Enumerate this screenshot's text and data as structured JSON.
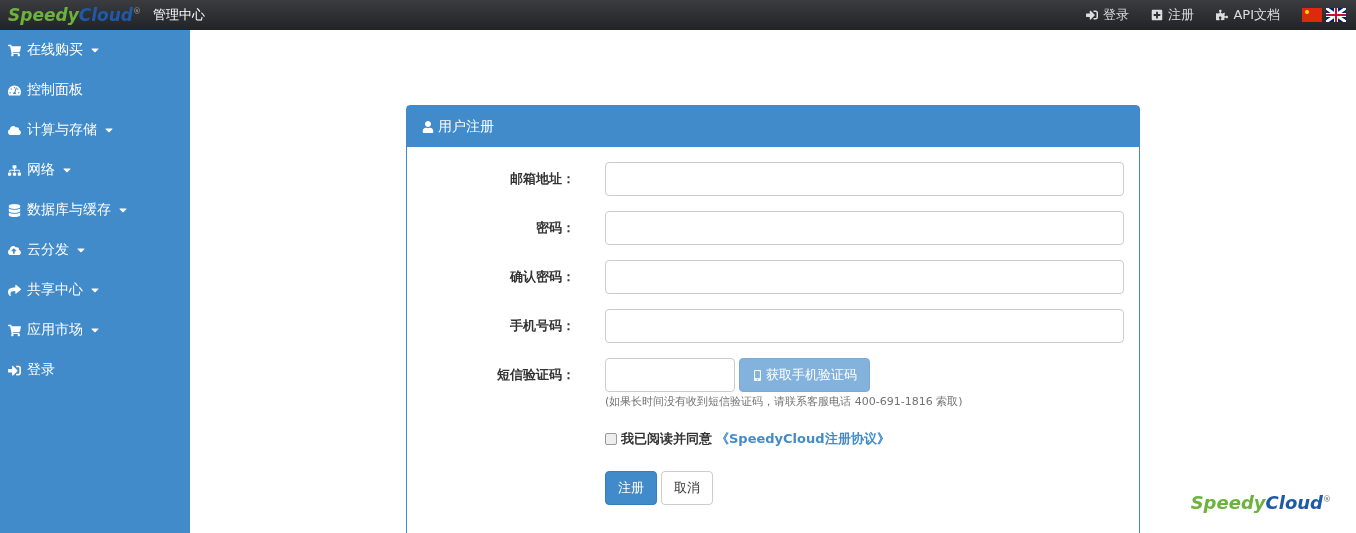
{
  "topbar": {
    "logo": {
      "first": "Speedy",
      "second": "Cloud",
      "mark": "®"
    },
    "title": "管理中心",
    "links": [
      {
        "kind": "login",
        "label": "登录"
      },
      {
        "kind": "register",
        "label": "注册"
      },
      {
        "kind": "api",
        "label": "API文档"
      }
    ],
    "flags": [
      {
        "kind": "cn"
      },
      {
        "kind": "uk"
      }
    ]
  },
  "sidebar": {
    "items": [
      {
        "kind": "cart",
        "label": "在线购买",
        "caret": true
      },
      {
        "kind": "dashboard",
        "label": "控制面板",
        "caret": false
      },
      {
        "kind": "cloud",
        "label": "计算与存储",
        "caret": true
      },
      {
        "kind": "sitemap",
        "label": "网络",
        "caret": true
      },
      {
        "kind": "database",
        "label": "数据库与缓存",
        "caret": true
      },
      {
        "kind": "upload",
        "label": "云分发",
        "caret": true
      },
      {
        "kind": "share",
        "label": "共享中心",
        "caret": true
      },
      {
        "kind": "cart",
        "label": "应用市场",
        "caret": true
      },
      {
        "kind": "login",
        "label": "登录",
        "caret": false
      }
    ]
  },
  "panel": {
    "title": "用户注册",
    "fields": [
      {
        "label": "邮箱地址：",
        "kind": "text"
      },
      {
        "label": "密码：",
        "kind": "text"
      },
      {
        "label": "确认密码：",
        "kind": "text"
      },
      {
        "label": "手机号码：",
        "kind": "text"
      },
      {
        "label": "短信验证码：",
        "kind": "sms",
        "button": {
          "label": "获取手机验证码",
          "disabled": true
        },
        "hint": "(如果长时间没有收到短信验证码，请联系客服电话 400-691-1816 索取)"
      }
    ],
    "agree": {
      "checked": false,
      "label": "我已阅读并同意",
      "link": "《SpeedyCloud注册协议》"
    },
    "buttons": [
      {
        "label": "注册",
        "kind": "primary"
      },
      {
        "label": "取消",
        "kind": "default"
      }
    ]
  },
  "footer_logo": {
    "first": "Speedy",
    "second": "Cloud",
    "mark": "®"
  }
}
